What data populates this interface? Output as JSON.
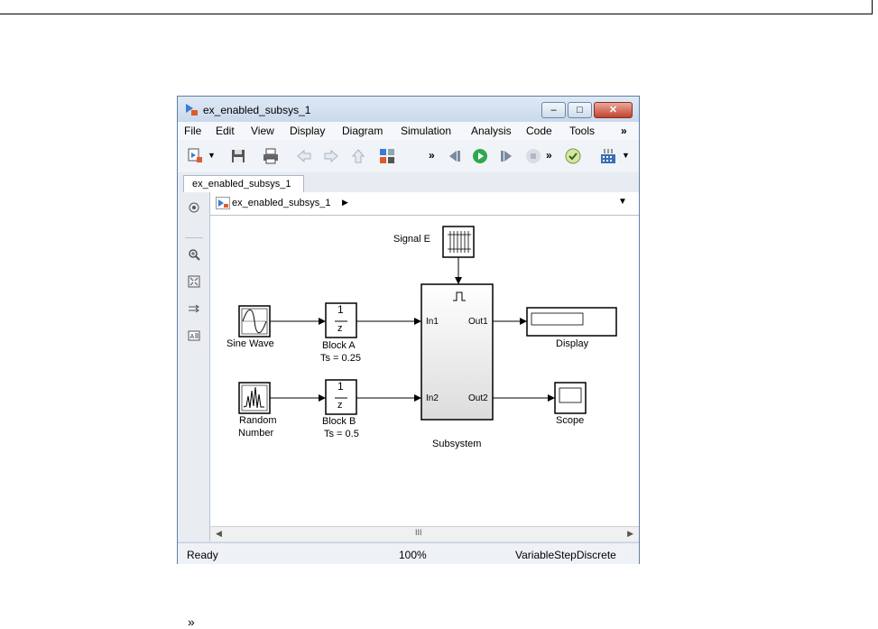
{
  "window": {
    "title": "ex_enabled_subsys_1",
    "controls": {
      "minimize": "–",
      "maximize": "□",
      "close": "✕"
    }
  },
  "menu": {
    "items": [
      "File",
      "Edit",
      "View",
      "Display",
      "Diagram",
      "Simulation",
      "Analysis",
      "Code",
      "Tools"
    ],
    "overflow": "»"
  },
  "toolbar": {
    "icons": [
      "new-model-icon",
      "save-icon",
      "print-icon",
      "back-icon",
      "forward-icon",
      "up-icon",
      "library-browser-icon",
      "step-back-icon",
      "run-icon",
      "step-forward-icon",
      "stop-icon",
      "check-icon",
      "build-icon"
    ],
    "overflow": "»"
  },
  "tab": {
    "label": "ex_enabled_subsys_1"
  },
  "address": {
    "path": "ex_enabled_subsys_1",
    "arrow": "▶",
    "dropdown": "▼"
  },
  "left_pane": {
    "icons": [
      "hide-browser-icon",
      "zoom-icon",
      "fit-to-view-icon",
      "signal-routing-icon",
      "annotation-icon"
    ],
    "collapse": "»"
  },
  "diagram": {
    "signal_e": "Signal E",
    "sine_wave": "Sine Wave",
    "block_a": {
      "num": "1",
      "den": "z",
      "name": "Block A",
      "ts": "Ts = 0.25"
    },
    "random_number": {
      "line1": "Random",
      "line2": "Number"
    },
    "block_b": {
      "num": "1",
      "den": "z",
      "name": "Block B",
      "ts": "Ts = 0.5"
    },
    "subsystem": {
      "name": "Subsystem",
      "in1": "In1",
      "in2": "In2",
      "out1": "Out1",
      "out2": "Out2"
    },
    "display": "Display",
    "scope": "Scope"
  },
  "scrollbar": {
    "left": "◀",
    "right": "▶",
    "grip": "III"
  },
  "status": {
    "ready": "Ready",
    "zoom": "100%",
    "solver": "VariableStepDiscrete"
  }
}
